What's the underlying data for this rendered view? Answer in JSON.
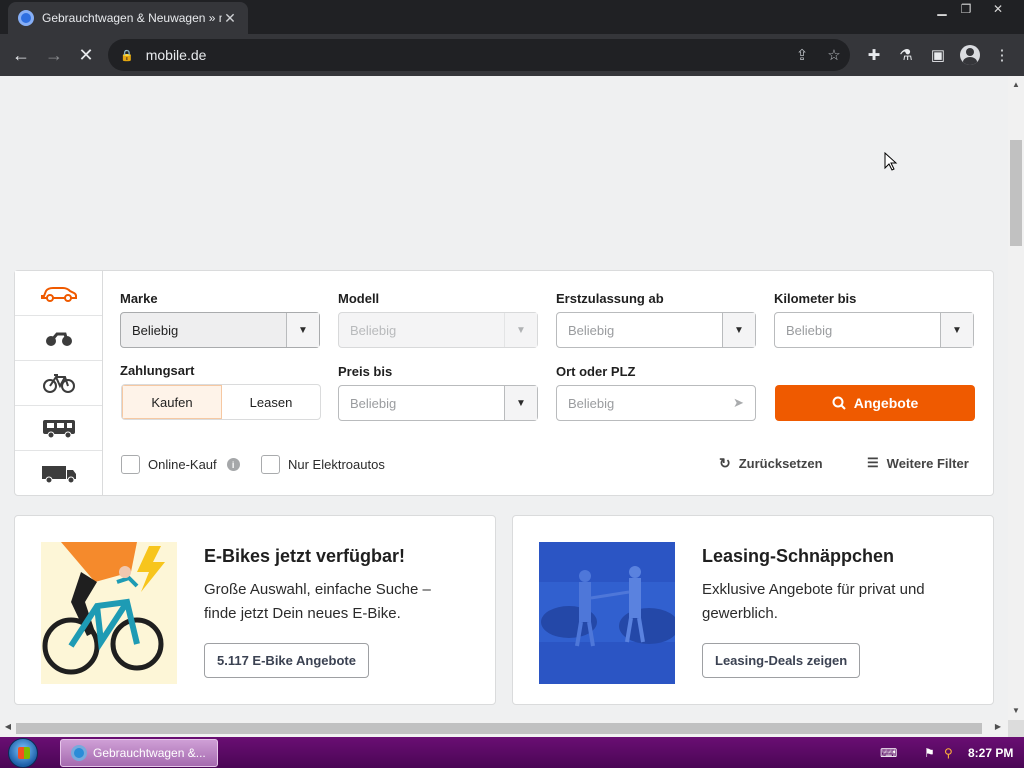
{
  "browser": {
    "tab_title": "Gebrauchtwagen & Neuwagen » mo",
    "url": "mobile.de"
  },
  "search": {
    "vehicle_tabs": [
      "car",
      "motorbike",
      "bicycle",
      "motorhome",
      "truck"
    ],
    "labels": {
      "marke": "Marke",
      "modell": "Modell",
      "erstzulassung": "Erstzulassung ab",
      "kilometer": "Kilometer bis",
      "zahlungsart": "Zahlungsart",
      "preis": "Preis bis",
      "ort": "Ort oder PLZ"
    },
    "values": {
      "marke": "Beliebig",
      "modell": "Beliebig",
      "erstzulassung": "Beliebig",
      "kilometer": "Beliebig",
      "preis": "Beliebig",
      "ort": "Beliebig"
    },
    "payment": {
      "kaufen": "Kaufen",
      "leasen": "Leasen",
      "selected": "Kaufen"
    },
    "submit_label": "Angebote",
    "online_kauf": "Online-Kauf",
    "nur_elektro": "Nur Elektroautos",
    "reset_label": "Zurücksetzen",
    "more_filters_label": "Weitere Filter",
    "accent_color": "#ef5a00"
  },
  "promos": [
    {
      "title": "E-Bikes jetzt verfügbar!",
      "text": "Große Auswahl, einfache Suche – finde jetzt Dein neues E-Bike.",
      "cta": "5.117 E-Bike Angebote"
    },
    {
      "title": "Leasing-Schnäppchen",
      "text": "Exklusive Angebote für privat und gewerblich.",
      "cta": "Leasing-Deals zeigen"
    }
  ],
  "taskbar": {
    "task_label": "Gebrauchtwagen &...",
    "clock": "8:27 PM"
  }
}
